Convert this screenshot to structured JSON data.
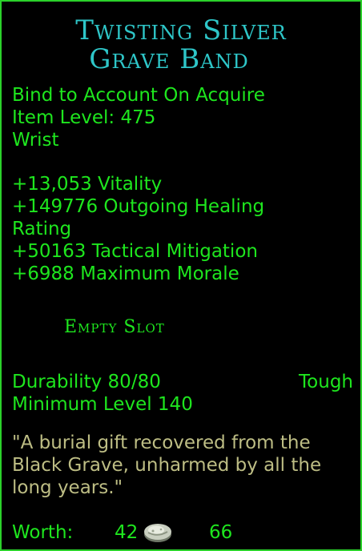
{
  "item": {
    "name_line1": "Twisting Silver",
    "name_line2": "Grave Band",
    "bind": "Bind to Account On Acquire",
    "item_level": "Item Level: 475",
    "slot_type": "Wrist",
    "stats": [
      "+13,053 Vitality",
      "+149776 Outgoing Healing Rating",
      "+50163 Tactical Mitigation",
      "+6988 Maximum Morale"
    ],
    "empty_slot": "Empty Slot",
    "durability": "Durability 80/80",
    "durability_type": "Tough",
    "min_level": "Minimum Level 140",
    "flavor_lines": [
      "\"A burial gift recovered from the",
      "Black Grave, unharmed by all the",
      "long years.\""
    ],
    "worth_label": "Worth:",
    "worth_silver": "42",
    "worth_copper": "66",
    "coin_icon": "silver-coin-icon"
  },
  "colors": {
    "border": "#2bd12b",
    "title": "#2ec6c8",
    "text": "#1ee61e",
    "flavor": "#bdbd84",
    "background": "#000000"
  }
}
